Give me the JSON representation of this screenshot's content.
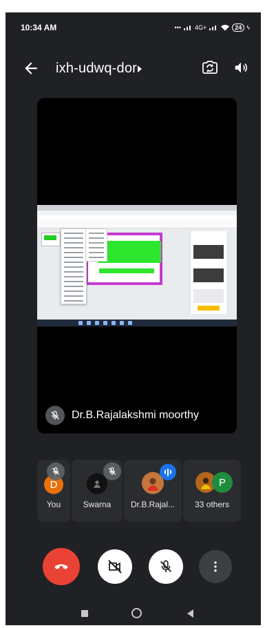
{
  "status_bar": {
    "time": "10:34 AM",
    "network_badge": "4G+",
    "battery": "24"
  },
  "app_bar": {
    "meeting_code": "ixh-udwq-dor"
  },
  "main_tile": {
    "participant_name": "Dr.B.Rajalakshmi moorthy"
  },
  "participants": [
    {
      "label": "You",
      "avatar_letter": "D",
      "avatar_color": "#e8710a"
    },
    {
      "label": "Swarna"
    },
    {
      "label": "Dr.B.Rajal..."
    },
    {
      "label": "33 others",
      "avatar_letter": "P",
      "avatar_color": "#1e8e3e"
    }
  ],
  "colors": {
    "end_call": "#ea4335",
    "speaking": "#1a73e8",
    "tile_bg": "#2b2c30",
    "screen_border": "#c53bd1"
  },
  "icons": [
    "back-arrow-icon",
    "switch-camera-icon",
    "speaker-icon",
    "mic-off-icon",
    "camera-off-icon",
    "end-call-icon",
    "more-vert-icon"
  ]
}
